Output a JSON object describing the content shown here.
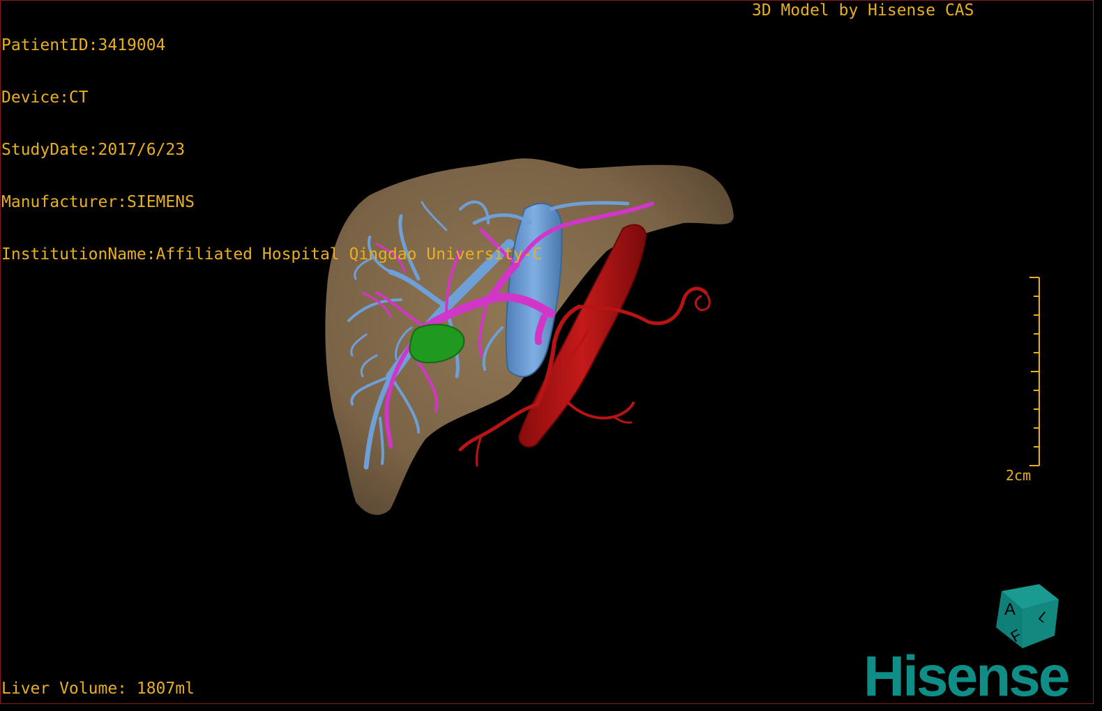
{
  "viewer": {
    "info_lines": [
      "PatientID:3419004",
      "Device:CT",
      "StudyDate:2017/6/23",
      "Manufacturer:SIEMENS",
      "InstitutionName:Affiliated Hospital Qingdao University-C"
    ],
    "brand_caption": "3D Model by Hisense CAS",
    "volume_label": "Liver Volume: 1807ml",
    "scale_label": "2cm",
    "logo_text": "Hisense",
    "orientation_cube": {
      "faces": [
        "A",
        "F",
        "L"
      ]
    }
  },
  "colors": {
    "overlay_text": "#e8b020",
    "liver": "#7e6749",
    "portal_vein": "#6e9fd6",
    "hepatic_vein": "#d236c8",
    "artery": "#b81414",
    "lesion": "#1f9a1f",
    "logo": "#0e8e86",
    "background": "#000000"
  },
  "icons": {
    "orientation_cube": "orientation-cube-icon"
  }
}
